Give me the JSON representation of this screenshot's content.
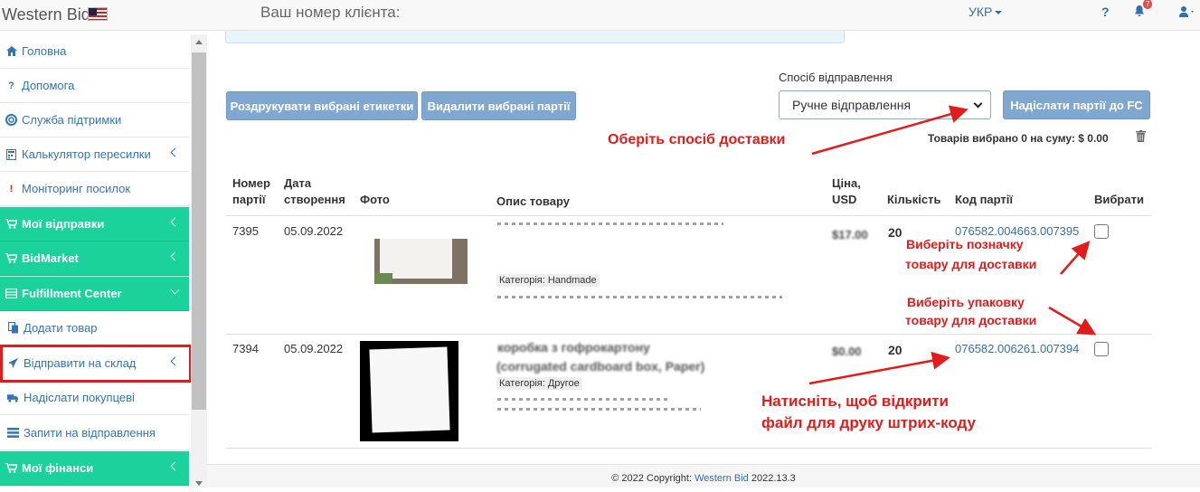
{
  "topbar": {
    "brand": "Western Bid",
    "client_label": "Ваш номер клієнта:",
    "language": "УКР",
    "help": "?",
    "notifications_count": "7"
  },
  "sidebar": {
    "items": [
      {
        "label": "Головна",
        "icon": "home-icon"
      },
      {
        "label": "Допомога",
        "icon": "question-icon"
      },
      {
        "label": "Служба підтримки",
        "icon": "lifebuoy-icon"
      },
      {
        "label": "Калькулятор пересилки",
        "icon": "calculator-icon"
      },
      {
        "label": "Моніторинг посилок",
        "icon": "exclamation-icon"
      },
      {
        "label": "Мої відправки",
        "icon": "cart-icon"
      },
      {
        "label": "BidMarket",
        "icon": "cart-icon"
      },
      {
        "label": "Fulfillment Center",
        "icon": "storage-icon"
      },
      {
        "label": "Додати товар",
        "icon": "copy-icon"
      },
      {
        "label": "Відправити на склад",
        "icon": "plane-icon"
      },
      {
        "label": "Надіслати покупцеві",
        "icon": "truck-icon"
      },
      {
        "label": "Запити на відправлення",
        "icon": "list-icon"
      },
      {
        "label": "Мої фінанси",
        "icon": "cart-icon"
      }
    ]
  },
  "toolbar": {
    "print_label": "Роздрукувати вибрані етикетки",
    "delete_label": "Видалити вибрані партії",
    "shipping_method_label": "Спосіб відправлення",
    "shipping_method_value": "Ручне відправлення",
    "send_label": "Надіслати партії до FC",
    "selected_summary": "Товарів вибрано 0 на суму: $ 0.00"
  },
  "table": {
    "headers": {
      "batch_no": "Номер партії",
      "created": "Дата створення",
      "photo": "Фото",
      "description": "Опис товару",
      "price": "Ціна, USD",
      "qty": "Кількість",
      "batch_code": "Код партії",
      "select": "Вибрати"
    },
    "rows": [
      {
        "batch_no": "7395",
        "created": "05.09.2022",
        "category": "Категорія: Handmade",
        "qty": "20",
        "batch_code": "076582.004663.007395"
      },
      {
        "batch_no": "7394",
        "created": "05.09.2022",
        "title_line2": "(corrugated cardboard box, Paper)",
        "category": "Категорія: Другое",
        "qty": "20",
        "batch_code": "076582.006261.007394"
      }
    ]
  },
  "annotations": {
    "choose_delivery": "Оберіть спосіб доставки",
    "choose_label_1": "Виберіть позначку",
    "choose_label_2": "товару для доставки",
    "choose_pack_1": "Виберіть упаковку",
    "choose_pack_2": "товару для доставки",
    "click_open_1": "Натисніть, щоб відкрити",
    "click_open_2": "файл для друку штрих-коду",
    "annotation_color": "#e31b1b"
  },
  "footer": {
    "copyright": "© 2022 Copyright:",
    "company": "Western Bid",
    "version": "2022.13.3"
  }
}
